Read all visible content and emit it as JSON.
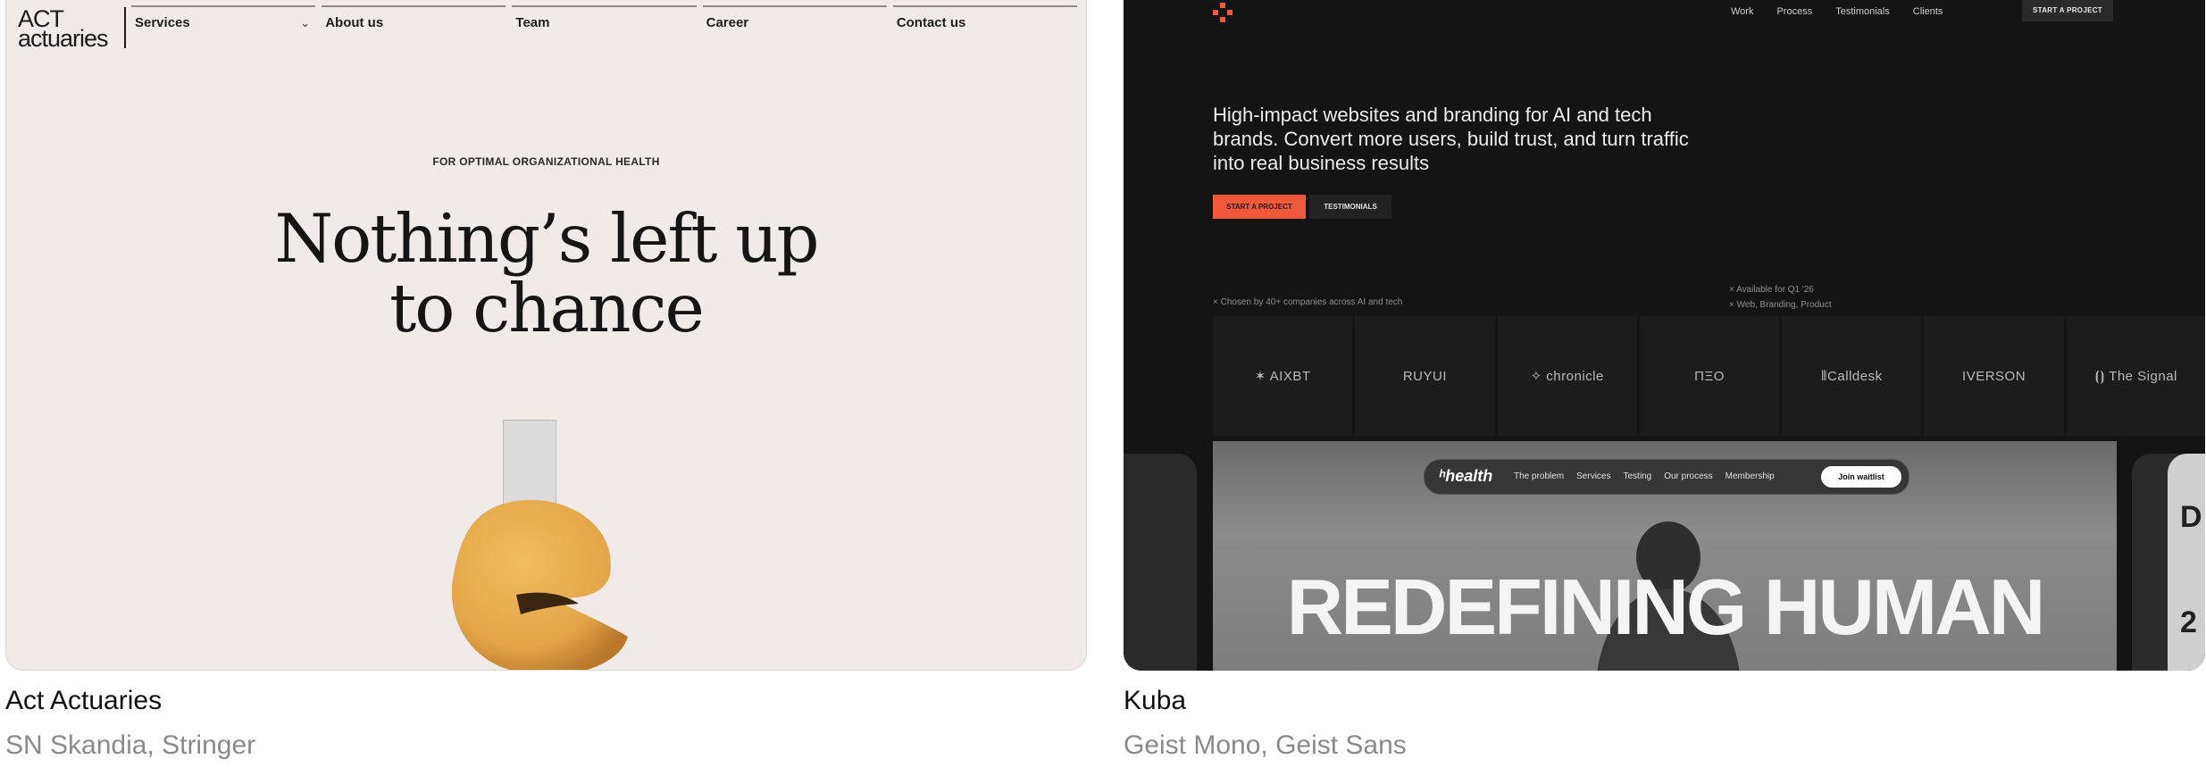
{
  "cards": [
    {
      "title": "Act Actuaries",
      "fonts_caption": "SN Skandia, Stringer",
      "logo_line1": "ACT",
      "logo_line2": "actuaries",
      "nav": [
        "Services",
        "About us",
        "Team",
        "Career",
        "Contact us"
      ],
      "eyebrow": "FOR OPTIMAL ORGANIZATIONAL HEALTH",
      "headline_line1": "Nothing’s left up",
      "headline_line2": "to chance",
      "colors": {
        "background": "#f0ebe9",
        "text": "#151515",
        "cookie": "#e3a548"
      }
    },
    {
      "title": "Kuba",
      "fonts_caption": "Geist Mono, Geist Sans",
      "nav": [
        "Work",
        "Process",
        "Testimonials",
        "Clients"
      ],
      "start_project": "START A PROJECT",
      "hero": "High-impact websites and branding for AI and tech brands. Convert more users, build trust, and turn traffic into real business results",
      "btn_primary": "START A PROJECT",
      "btn_secondary": "TESTIMONIALS",
      "chosen": "× Chosen by 40+ companies across AI and tech",
      "avail_line1": "× Available for Q1 '26",
      "avail_line2": "× Web, Branding, Product",
      "client_logos": [
        "✶ AIXBT",
        "RUYUI",
        "✧ chronicle",
        "ΠΞO",
        "⦀Calldesk",
        "IVERSON",
        "⦗⦘ The Signal"
      ],
      "preview": {
        "brand": "ʰhealth",
        "links": [
          "The problem",
          "Services",
          "Testing",
          "Our process",
          "Membership"
        ],
        "cta": "Join waitlist",
        "headline": "REDEFINING HUMAN"
      },
      "side_right_letters": [
        "D",
        "2"
      ],
      "colors": {
        "background": "#141414",
        "accent": "#f2593a",
        "text": "#ececec"
      }
    }
  ]
}
